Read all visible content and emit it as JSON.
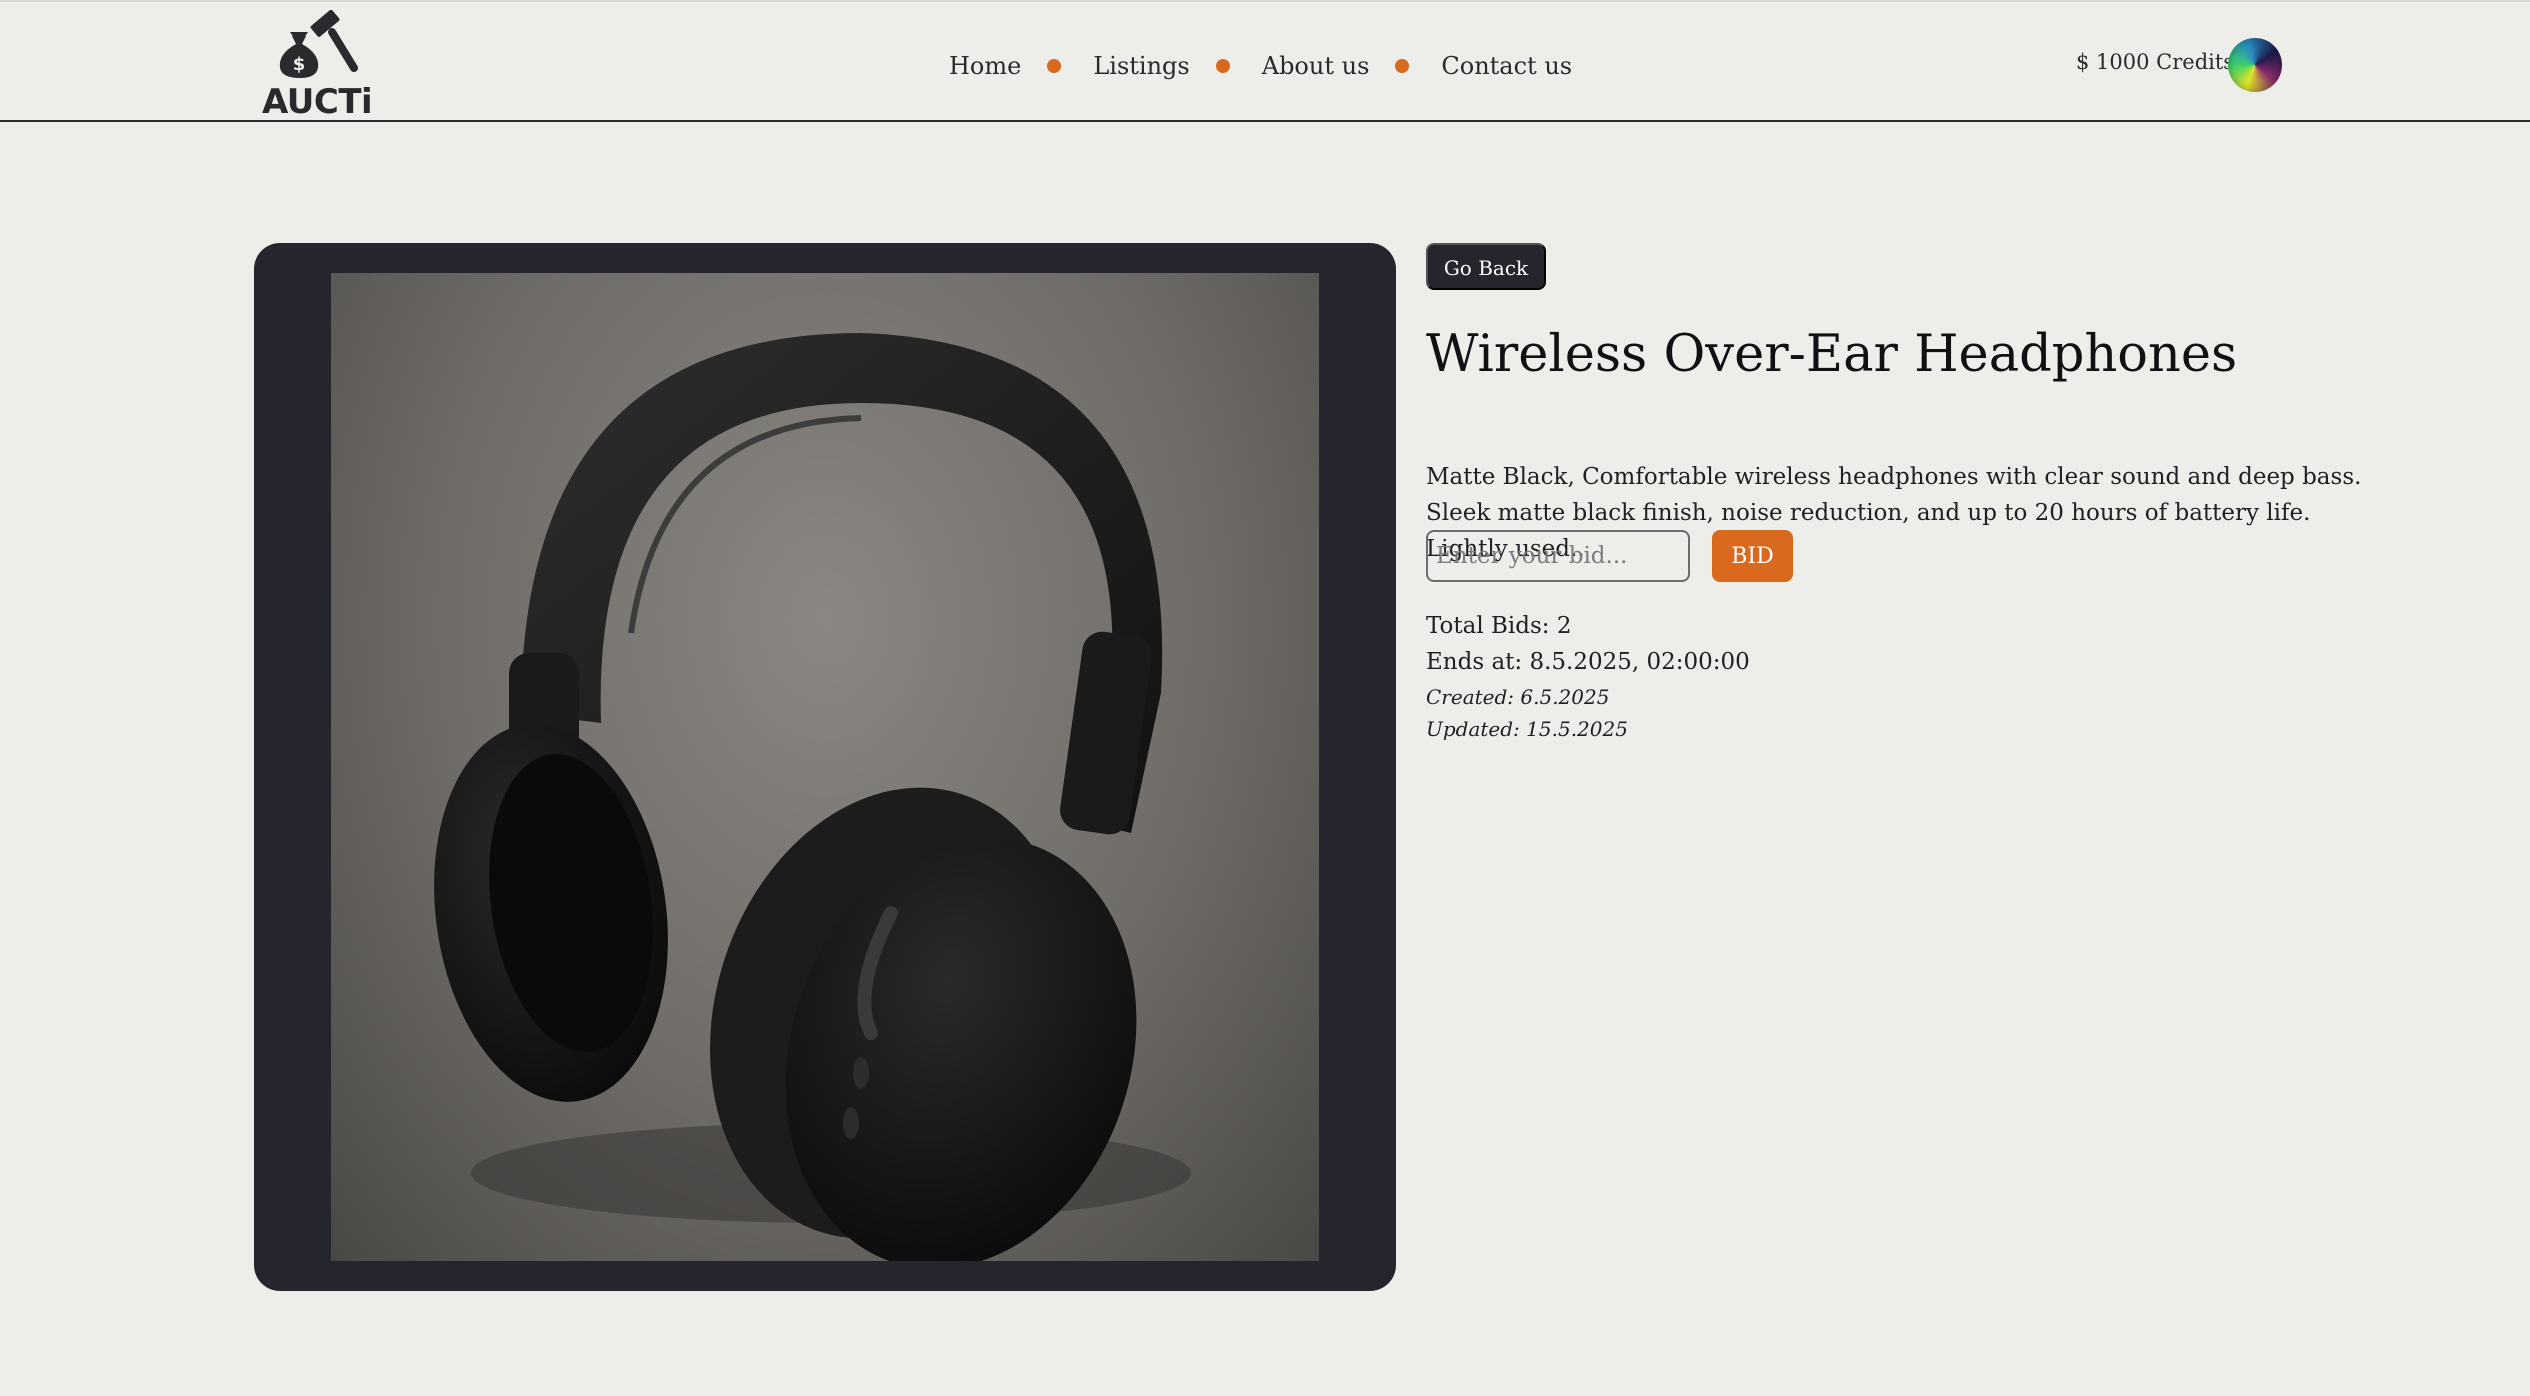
{
  "brand": {
    "name": "AUCTi",
    "logo_icon": "money-bag-gavel-icon"
  },
  "nav": {
    "items": [
      {
        "label": "Home"
      },
      {
        "label": "Listings"
      },
      {
        "label": "About us"
      },
      {
        "label": "Contact us"
      }
    ],
    "separator_color": "#d8691d"
  },
  "user": {
    "credits": "$ 1000 Credits",
    "avatar_icon": "user-avatar-gradient"
  },
  "listing": {
    "back_label": "Go Back",
    "title": "Wireless Over-Ear Headphones",
    "description": "Matte Black, Comfortable wireless headphones with clear sound and deep bass. Sleek matte black finish, noise reduction, and up to 20 hours of battery life. Lightly used..",
    "image_alt": "Black wireless over-ear headphones",
    "bid": {
      "placeholder": "Enter your bid...",
      "value": "",
      "button_label": "BID"
    },
    "total_bids": "Total Bids: 2",
    "ends_at": "Ends at: 8.5.2025, 02:00:00",
    "created": "Created: 6.5.2025",
    "updated": "Updated: 15.5.2025"
  },
  "colors": {
    "accent": "#d8691d",
    "dark": "#25252d",
    "background": "#edeeea"
  }
}
